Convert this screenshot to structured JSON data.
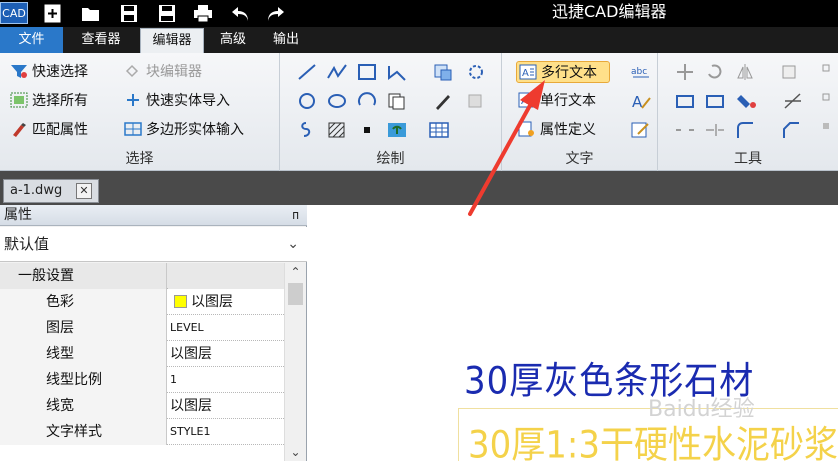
{
  "app": {
    "logo_text": "CAD",
    "window_title": "迅捷CAD编辑器"
  },
  "menu": {
    "file": "文件",
    "tabs": [
      "查看器",
      "编辑器",
      "高级",
      "输出"
    ],
    "active_tab": "编辑器"
  },
  "ribbon": {
    "select_group": {
      "label": "选择",
      "quick_select": "快速选择",
      "block_editor": "块编辑器",
      "select_all": "选择所有",
      "quick_entity_import": "快速实体导入",
      "match_properties": "匹配属性",
      "polygon_entity_input": "多边形实体输入"
    },
    "draw_group": {
      "label": "绘制"
    },
    "text_group": {
      "label": "文字",
      "mtext": "多行文本",
      "single_text": "单行文本",
      "attribute_definition": "属性定义"
    },
    "tools_group": {
      "label": "工具"
    }
  },
  "document": {
    "tab_name": "a-1.dwg",
    "close_symbol": "✕"
  },
  "properties": {
    "title": "属性",
    "pin_symbol": "ᴨ",
    "selected": "默认值",
    "category": "一般设置",
    "rows": [
      {
        "key": "色彩",
        "value": "以图层"
      },
      {
        "key": "图层",
        "value": "LEVEL"
      },
      {
        "key": "线型",
        "value": "以图层"
      },
      {
        "key": "线型比例",
        "value": "1"
      },
      {
        "key": "线宽",
        "value": "以图层"
      },
      {
        "key": "文字样式",
        "value": "STYLE1"
      }
    ]
  },
  "canvas": {
    "text_line_1": "30厚灰色条形石材",
    "text_line_2": "30厚1:3干硬性水泥砂浆",
    "watermark": "Baidu经验"
  },
  "colors": {
    "accent": "#2a78c9",
    "text_blue": "#1a2bb0",
    "text_yellow": "#f4d24a",
    "swatch_yellow": "#ffff00",
    "arrow_red": "#ee3b2f"
  }
}
